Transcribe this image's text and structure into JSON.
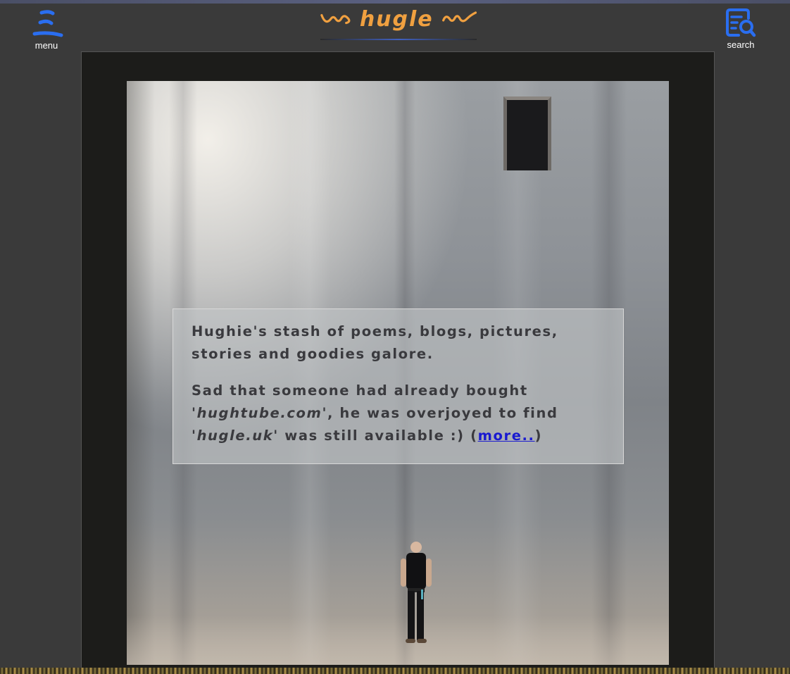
{
  "header": {
    "menu_label": "menu",
    "search_label": "search",
    "brand_title": "hugle",
    "accent_color": "#f0a040",
    "icon_color": "#2a6ef0"
  },
  "intro": {
    "line1": "Hughie's stash of poems, blogs, pictures, stories and goodies galore.",
    "p2_part1": "Sad that someone had already bought ",
    "p2_domain1": "'hughtube.com'",
    "p2_part2": ", he was overjoyed to find ",
    "p2_domain2": "'hugle.uk'",
    "p2_part3": " was still available :) (",
    "more_link": "more..",
    "p2_part4": ")"
  },
  "icons": {
    "menu": "menu-icon",
    "search": "search-document-icon",
    "brand_left": "swirl-ornament-icon",
    "brand_right": "swirl-ornament-icon"
  }
}
